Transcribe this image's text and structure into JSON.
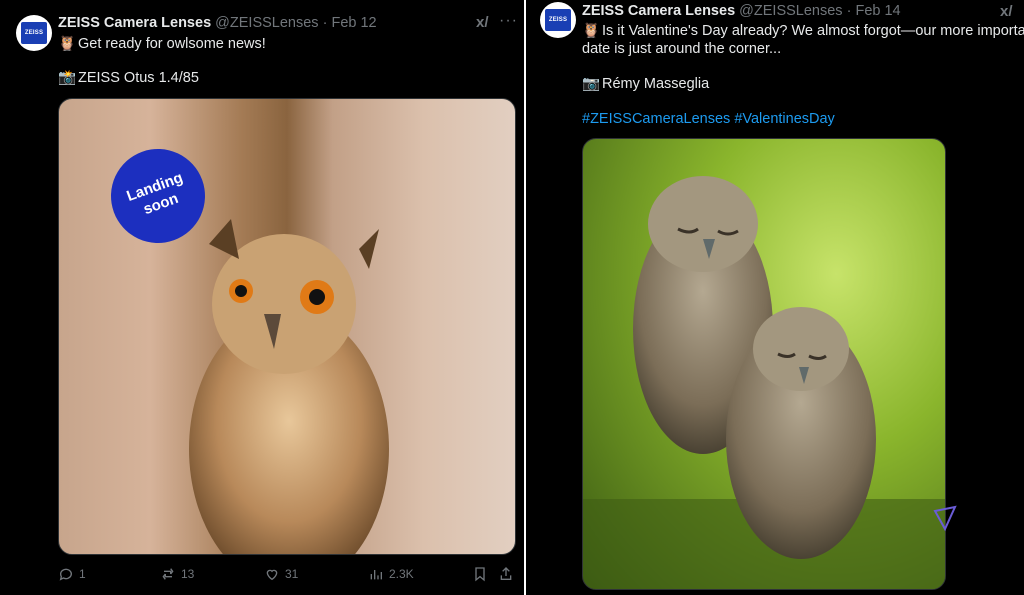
{
  "left_post": {
    "author_name": "ZEISS Camera Lenses",
    "handle": "@ZEISSLenses",
    "separator": "·",
    "date": "Feb 12",
    "avatar_logo_text": "ZEISS",
    "text_line1": "Get ready for owlsome news!",
    "text_line2": "ZEISS Otus 1.4/85",
    "emoji1": "🦉",
    "emoji2": "📸",
    "badge_text_line1": "Landing",
    "badge_text_line2": "soon",
    "grok_icon": "grok-icon",
    "more_label": "···",
    "actions": {
      "replies": "1",
      "reposts": "13",
      "likes": "31",
      "views": "2.3K"
    }
  },
  "right_post": {
    "author_name": "ZEISS Camera Lenses",
    "handle": "@ZEISSLenses",
    "separator": "·",
    "date": "Feb 14",
    "avatar_logo_text": "ZEISS",
    "text_line1": "Is it Valentine's Day already? We almost forgot—our more important",
    "text_line2": "date is just around the corner...",
    "credit": "Rémy Masseglia",
    "hashtags": "#ZEISSCameraLenses #ValentinesDay",
    "emoji1": "🦉",
    "emoji2": "📷",
    "grok_icon": "grok-icon"
  },
  "colors": {
    "background": "#000000",
    "text": "#e7e9ea",
    "muted": "#71767b",
    "link": "#1d9bf0",
    "zeiss_blue": "#1c2fbf"
  }
}
